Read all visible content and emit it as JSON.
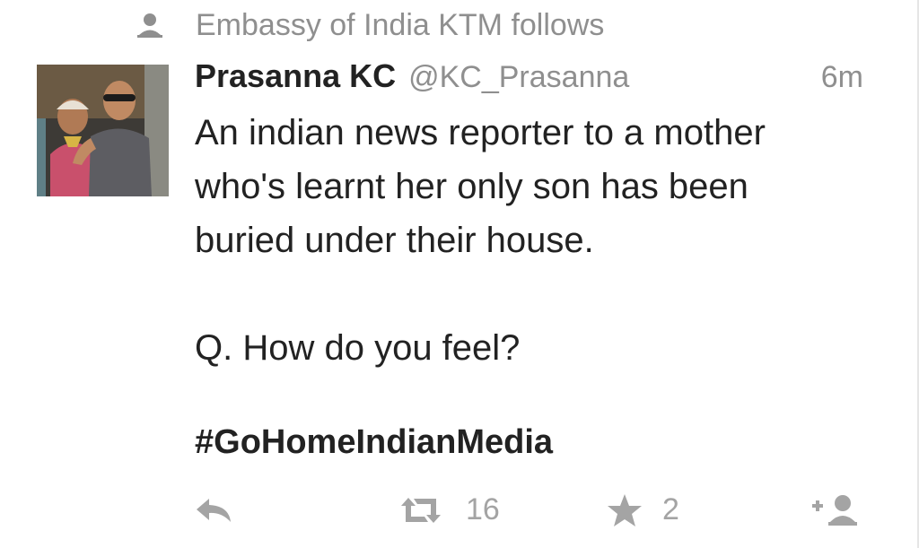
{
  "context": {
    "icon": "person-icon",
    "text": "Embassy of India KTM follows"
  },
  "tweet": {
    "author_name": "Prasanna KC",
    "author_handle": "@KC_Prasanna",
    "timestamp": "6m",
    "body": "An indian news reporter to a mother\nwho's learnt her only son has been\nburied under their house.\n\nQ. How do you feel?",
    "hashtag": "#GoHomeIndianMedia",
    "retweet_count": "16",
    "favorite_count": "2"
  },
  "actions": {
    "reply_icon": "reply-icon",
    "retweet_icon": "retweet-icon",
    "favorite_icon": "star-icon",
    "follow_icon": "add-user-icon"
  },
  "colors": {
    "text": "#222222",
    "muted": "#8f8f8f",
    "action": "#a4a4a4"
  }
}
